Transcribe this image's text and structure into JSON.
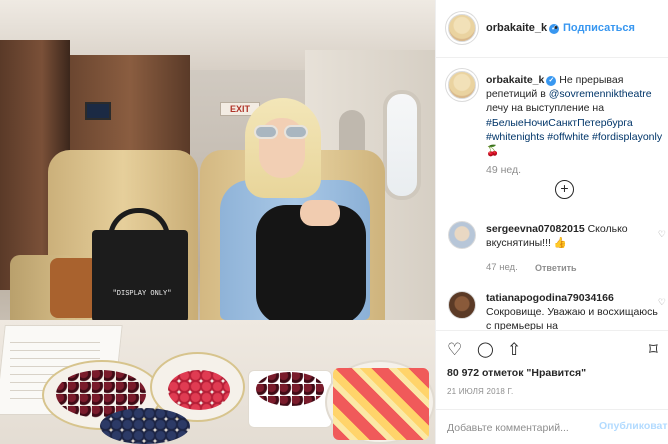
{
  "header": {
    "username": "orbakaite_k",
    "verified_mark": "✓",
    "separator": "•",
    "follow_label": "Подписаться"
  },
  "photo": {
    "exit_sign": "EXIT",
    "bag_text": "\"DISPLAY ONLY\""
  },
  "post": {
    "username": "orbakaite_k",
    "caption_text_1": "Не прерывая репетиций в",
    "caption_mention": "@sovremenniktheatre",
    "caption_text_2": "лечу на выступление на",
    "caption_tags_1": "#БелыеНочиСанктПетербурга",
    "caption_tags_2": "#whitenights #offwhite #fordisplayonly",
    "caption_emoji": "🍒",
    "age": "49 нед."
  },
  "load_more_symbol": "+",
  "comments": [
    {
      "username": "sergeevna07082015",
      "text": "Сколько вкуснятины!!! 👍",
      "age": "47 нед.",
      "reply_label": "Ответить"
    },
    {
      "username": "tatianapogodina79034166",
      "text": "Сокровище. Уважаю и восхищаюсь с премьеры на"
    }
  ],
  "actions": {
    "like_icon": "♡",
    "comment_icon": "◯",
    "share_icon": "⇧",
    "save_icon": "⌑",
    "likes_text": "80 972 отметок \"Нравится\"",
    "date": "21 ИЮЛЯ 2018 Г."
  },
  "add_comment": {
    "placeholder": "Добавьте комментарий...",
    "post_label": "Опубликовать"
  },
  "colors": {
    "accent": "#3897f0",
    "hashtag": "#003569",
    "muted": "#8e8e8e"
  }
}
